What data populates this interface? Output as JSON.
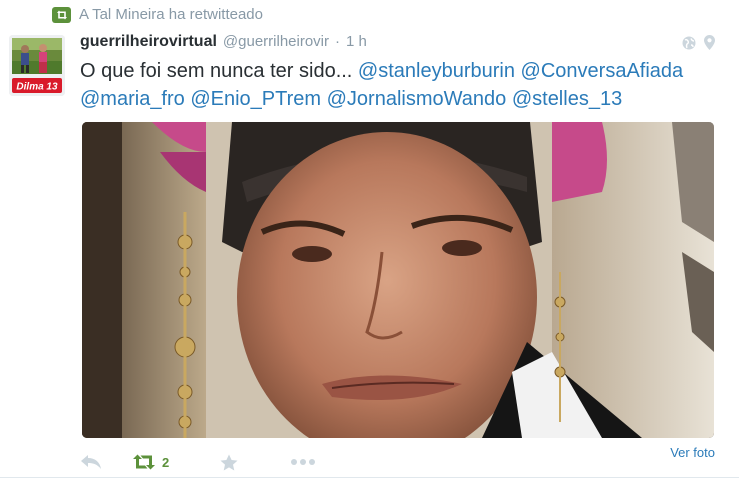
{
  "context": {
    "text": "A Tal Mineira ha retwitteado"
  },
  "avatar": {
    "badge_text": "Dilma 13"
  },
  "tweet": {
    "fullname": "guerrilheirovirtual",
    "username": "@guerrilheirovir",
    "separator": "·",
    "time": "1 h",
    "text_intro": "O que foi sem nunca ter sido... ",
    "mentions": [
      "@stanleyburburin",
      "@ConversaAfiada",
      "@maria_fro",
      "@Enio_PTrem",
      "@JornalismoWando",
      "@stelles_13"
    ]
  },
  "actions": {
    "retweet_count": "2",
    "view_photo": "Ver foto"
  },
  "colors": {
    "link": "#2b7bb9",
    "retweet_green": "#5c913b",
    "muted": "#8899a6",
    "text": "#292f33"
  }
}
